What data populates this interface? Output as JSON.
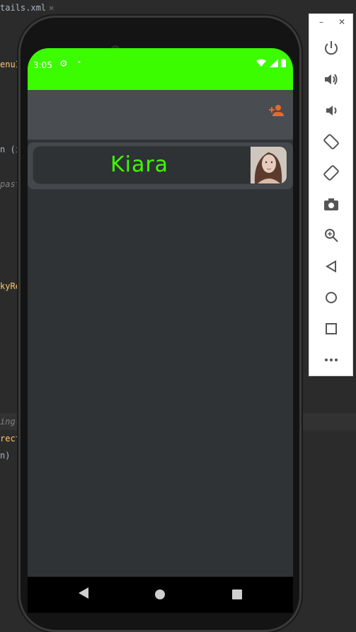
{
  "ide": {
    "tab_label": "tails.xml",
    "tab_close": "✕",
    "code_fragments": [
      {
        "text": "enuI",
        "color": "#ffc66d"
      },
      {
        "text": "n (i",
        "color": "#a9b7c6"
      },
      {
        "text": "past",
        "color": "#808080"
      },
      {
        "text": "kyRe",
        "color": "#ffc66d"
      },
      {
        "text": "ing(",
        "color": "#808080"
      },
      {
        "text": "rect",
        "color": "#ffc66d"
      },
      {
        "text": "n)",
        "color": "#a9b7c6"
      }
    ]
  },
  "phone": {
    "status_bar": {
      "time": "3:05",
      "settings_icon": "gear-icon",
      "dot": "•",
      "icons": [
        "wifi-icon",
        "signal-icon",
        "battery-icon"
      ],
      "color": "#3cfc00"
    },
    "app_bar": {
      "action_icon": "add-user-icon",
      "action_color": "#e8692a"
    },
    "list": [
      {
        "name": "Kiara",
        "avatar": "person-photo"
      }
    ],
    "nav": [
      "back-icon",
      "home-icon",
      "recents-icon"
    ]
  },
  "emulator_panel": {
    "minimize": "–",
    "close": "✕",
    "buttons": [
      "power-icon",
      "volume-up-icon",
      "volume-down-icon",
      "rotate-left-icon",
      "rotate-right-icon",
      "camera-icon",
      "zoom-icon",
      "back-icon",
      "home-icon",
      "overview-icon",
      "more-icon"
    ]
  }
}
